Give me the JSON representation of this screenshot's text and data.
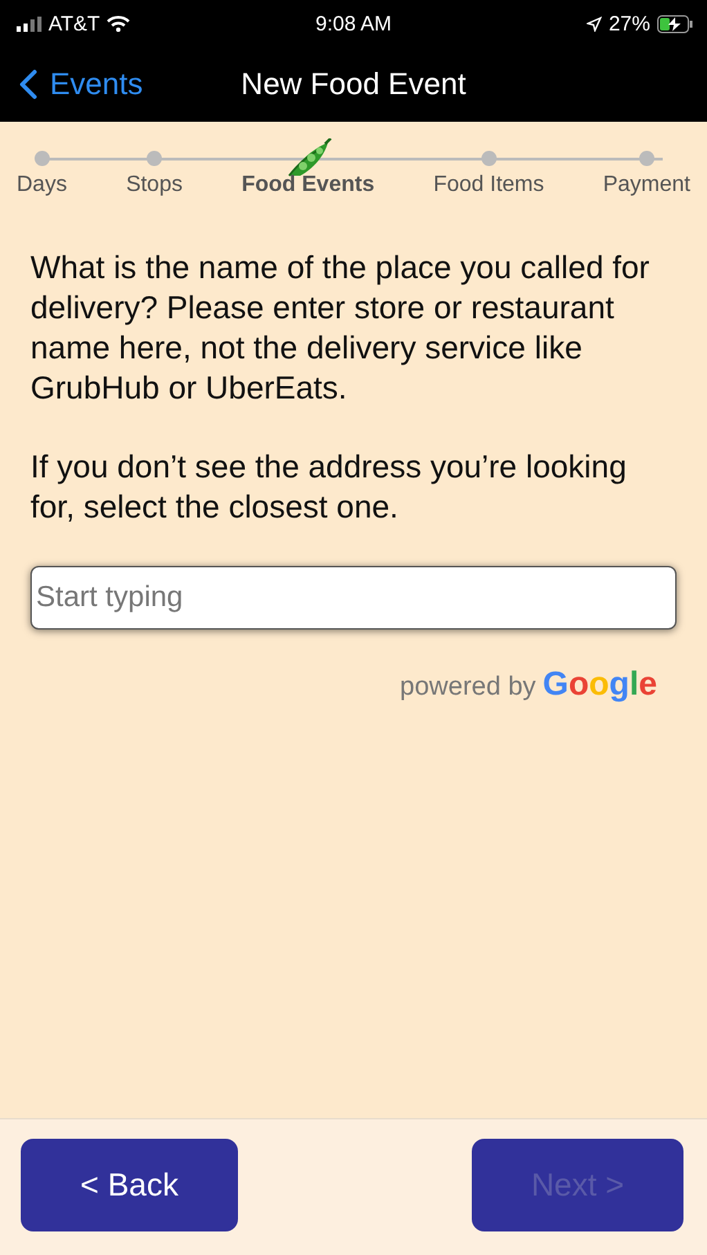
{
  "status_bar": {
    "carrier": "AT&T",
    "time": "9:08 AM",
    "battery": "27%"
  },
  "nav": {
    "back": "Events",
    "title": "New Food Event"
  },
  "steps": [
    {
      "label": "Days",
      "selected": false
    },
    {
      "label": "Stops",
      "selected": false
    },
    {
      "label": "Food Events",
      "selected": true
    },
    {
      "label": "Food Items",
      "selected": false
    },
    {
      "label": "Payment",
      "selected": false
    }
  ],
  "prompt": "What is the name of the place you called for delivery? Please enter store or restaurant name here, not the delivery service like GrubHub or UberEats.",
  "hint": "If you don’t see the address you’re looking for, select the closest one.",
  "search": {
    "placeholder": "Start typing"
  },
  "attribution": {
    "text": "powered by",
    "brand": "Google"
  },
  "buttons": [
    {
      "label": "< Back",
      "disabled": false
    },
    {
      "label": "Next >",
      "disabled": true
    }
  ]
}
